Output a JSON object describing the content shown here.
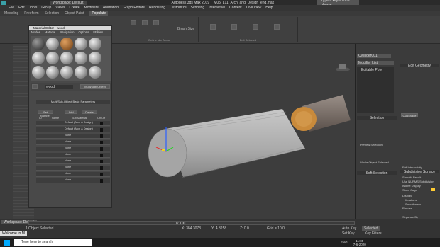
{
  "title": {
    "workspace": "Workspace: Default",
    "app": "Autodesk 3ds Max 2019",
    "file": "M05_L11_Arch_and_Design_end.max",
    "search": "Type a keyword or phrase"
  },
  "menu": [
    "File",
    "Edit",
    "Tools",
    "Group",
    "Views",
    "Create",
    "Modifiers",
    "Animation",
    "Graph Editors",
    "Rendering",
    "Customize",
    "Scripting",
    "Interactive",
    "Content",
    "Civil View",
    "Help"
  ],
  "ribbon_tabs": [
    "Modeling",
    "Freeform",
    "Selection",
    "Object Paint",
    "Populate"
  ],
  "ribbon_groups": {
    "define_idle": "Define Idle Areas",
    "edit_selected": "Edit Selected",
    "brush_size": "Brush Size"
  },
  "material_editor": {
    "title": "Material Editor - wood",
    "menu": [
      "Modes",
      "Material",
      "Navigation",
      "Options",
      "Utilities"
    ],
    "material_name": "wood",
    "type_label": "Multi/Sub-Object",
    "params_header": "Multi/Sub-Object Basic Parameters",
    "set_number": "Set Number",
    "add": "Add",
    "delete": "Delete",
    "col_id": "ID",
    "col_name": "Name",
    "col_sub": "Sub-Material",
    "col_onoff": "On/Off",
    "rows": [
      {
        "sub": "Default (Arch & Design)"
      },
      {
        "sub": "Default (Arch & Design)"
      },
      {
        "sub": "None"
      },
      {
        "sub": "None"
      },
      {
        "sub": "None"
      },
      {
        "sub": "None"
      },
      {
        "sub": "None"
      },
      {
        "sub": "None"
      },
      {
        "sub": "None"
      },
      {
        "sub": "None"
      }
    ]
  },
  "command_panel": {
    "object": "Cylinder001",
    "modifier_list": "Modifier List",
    "stack_item": "Editable Poly",
    "selection": "Selection",
    "soft_selection": "Soft Selection",
    "edit_geometry": "Edit Geometry",
    "subdivision": "Subdivision Surface",
    "smooth_result": "Smooth Result",
    "use_nurms": "Use NURMS Subdivision",
    "isoline": "Isoline Display",
    "show_cage": "Show Cage",
    "display": "Display",
    "iterations": "Iterations",
    "smoothness": "Smoothness",
    "render": "Render",
    "sep_by": "Separate By",
    "whole_selected": "Whole Object Selected",
    "preview_selection": "Preview Selection",
    "quickslice": "QuickSlice",
    "full_interactivity": "Full Interactivity"
  },
  "status": {
    "selected": "1 Object Selected",
    "frame": "0 / 100",
    "x": "X: 384.3078",
    "y": "Y: 4.3258",
    "z": "Z: 0.0",
    "grid": "Grid = 10.0",
    "auto": "Auto Key",
    "selected_dd": "Selected",
    "setkey": "Set Key",
    "filters": "Key Filters...",
    "welcome": "Welcome to M",
    "workspace": "Workspace: Default"
  },
  "taskbar": {
    "search": "Type here to search",
    "time": "11:05",
    "date": "7-6-2020",
    "lang": "ENG"
  },
  "colors": {
    "accent": "#3aa0a8",
    "wood": "#c98a3b",
    "taskbar": "#1f1f1f",
    "viewport": "#3d3d3d"
  }
}
